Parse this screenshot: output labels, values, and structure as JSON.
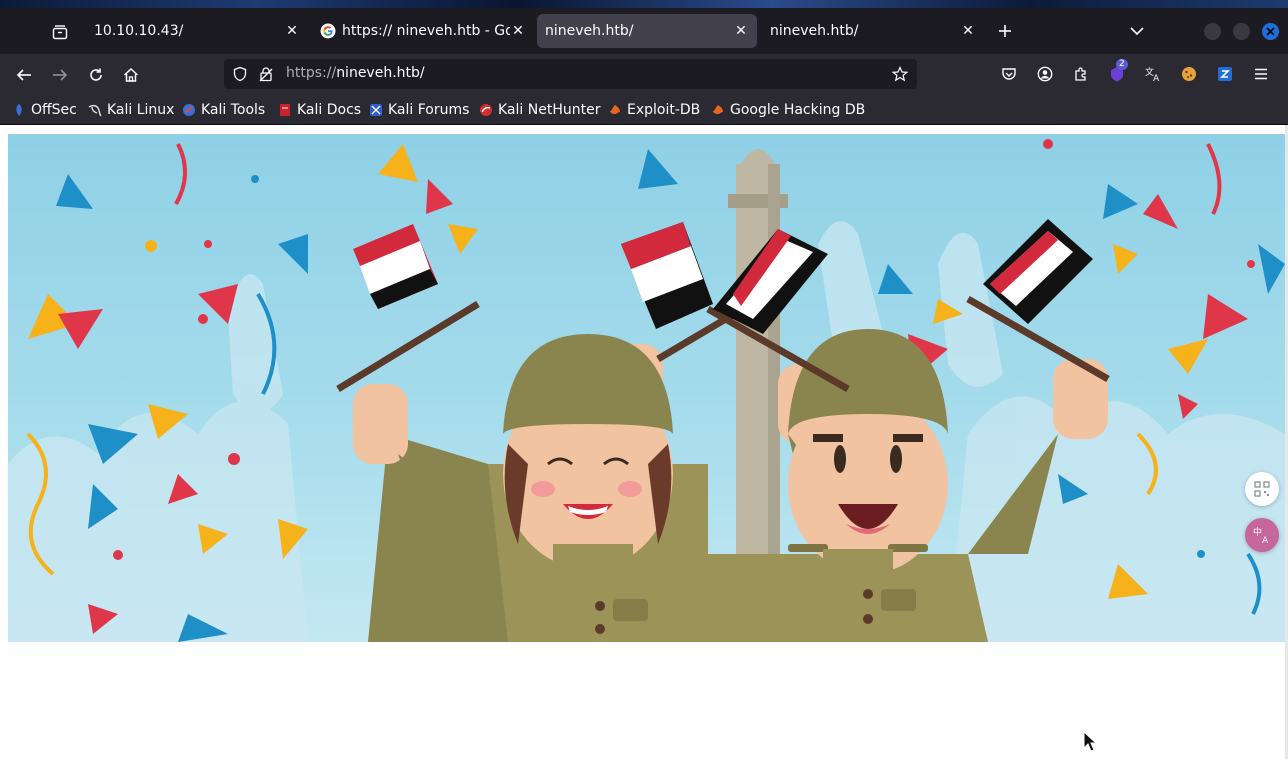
{
  "browser": {
    "tabs": [
      {
        "title": "10.10.10.43/",
        "active": false,
        "favicon": "none"
      },
      {
        "title": "https:// nineveh.htb - Goo",
        "active": false,
        "favicon": "google-g-icon"
      },
      {
        "title": "nineveh.htb/",
        "active": true,
        "favicon": "none"
      },
      {
        "title": "nineveh.htb/",
        "active": false,
        "favicon": "none"
      }
    ],
    "url": {
      "scheme": "https://",
      "host": "nineveh.htb/"
    },
    "extension_badge": "2",
    "bookmarks": [
      {
        "label": "OffSec",
        "icon": "offsec-icon"
      },
      {
        "label": "Kali Linux",
        "icon": "kali-dragon-icon"
      },
      {
        "label": "Kali Tools",
        "icon": "kali-tools-icon"
      },
      {
        "label": "Kali Docs",
        "icon": "kali-docs-icon"
      },
      {
        "label": "Kali Forums",
        "icon": "kali-forums-icon"
      },
      {
        "label": "Kali NetHunter",
        "icon": "nethunter-icon"
      },
      {
        "label": "Exploit-DB",
        "icon": "exploit-db-icon"
      },
      {
        "label": "Google Hacking DB",
        "icon": "ghdb-icon"
      }
    ],
    "toolbar_icons": [
      "pocket-icon",
      "account-icon",
      "extensions-icon",
      "shield-extension-icon",
      "translate-icon",
      "cookie-icon",
      "z-extension-icon",
      "menu-icon"
    ],
    "colors": {
      "tabbar": "#1c1b22",
      "toolbar": "#2b2a33",
      "active_tab": "#42414d",
      "text": "#fbfbfe"
    }
  },
  "page": {
    "hero_image": "celebration-soldiers-with-iraqi-flags-illustration",
    "side_widgets": [
      "qr-code-icon",
      "translate-widget-icon"
    ]
  }
}
